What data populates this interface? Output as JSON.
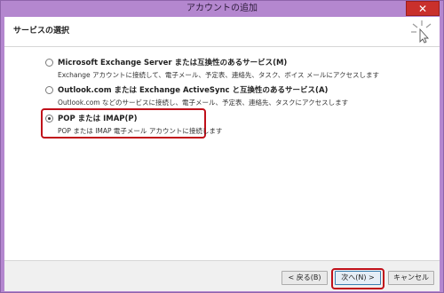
{
  "window": {
    "title": "アカウントの追加",
    "close_glyph": "✕"
  },
  "header": {
    "title": "サービスの選択",
    "icon": "sparkle-cursor-icon"
  },
  "options": [
    {
      "label": "Microsoft Exchange Server または互換性のあるサービス(M)",
      "description": "Exchange アカウントに接続して、電子メール、予定表、連絡先、タスク、ボイス メールにアクセスします",
      "selected": false
    },
    {
      "label": "Outlook.com または Exchange ActiveSync と互換性のあるサービス(A)",
      "description": "Outlook.com などのサービスに接続し、電子メール、予定表、連絡先、タスクにアクセスします",
      "selected": false
    },
    {
      "label": "POP または IMAP(P)",
      "description": "POP または IMAP 電子メール アカウントに接続します",
      "selected": true
    }
  ],
  "footer": {
    "back_label": "< 戻る(B)",
    "next_label": "次へ(N) >",
    "cancel_label": "キャンセル"
  },
  "colors": {
    "window_frame": "#b487cf",
    "highlight": "#c0101a"
  }
}
